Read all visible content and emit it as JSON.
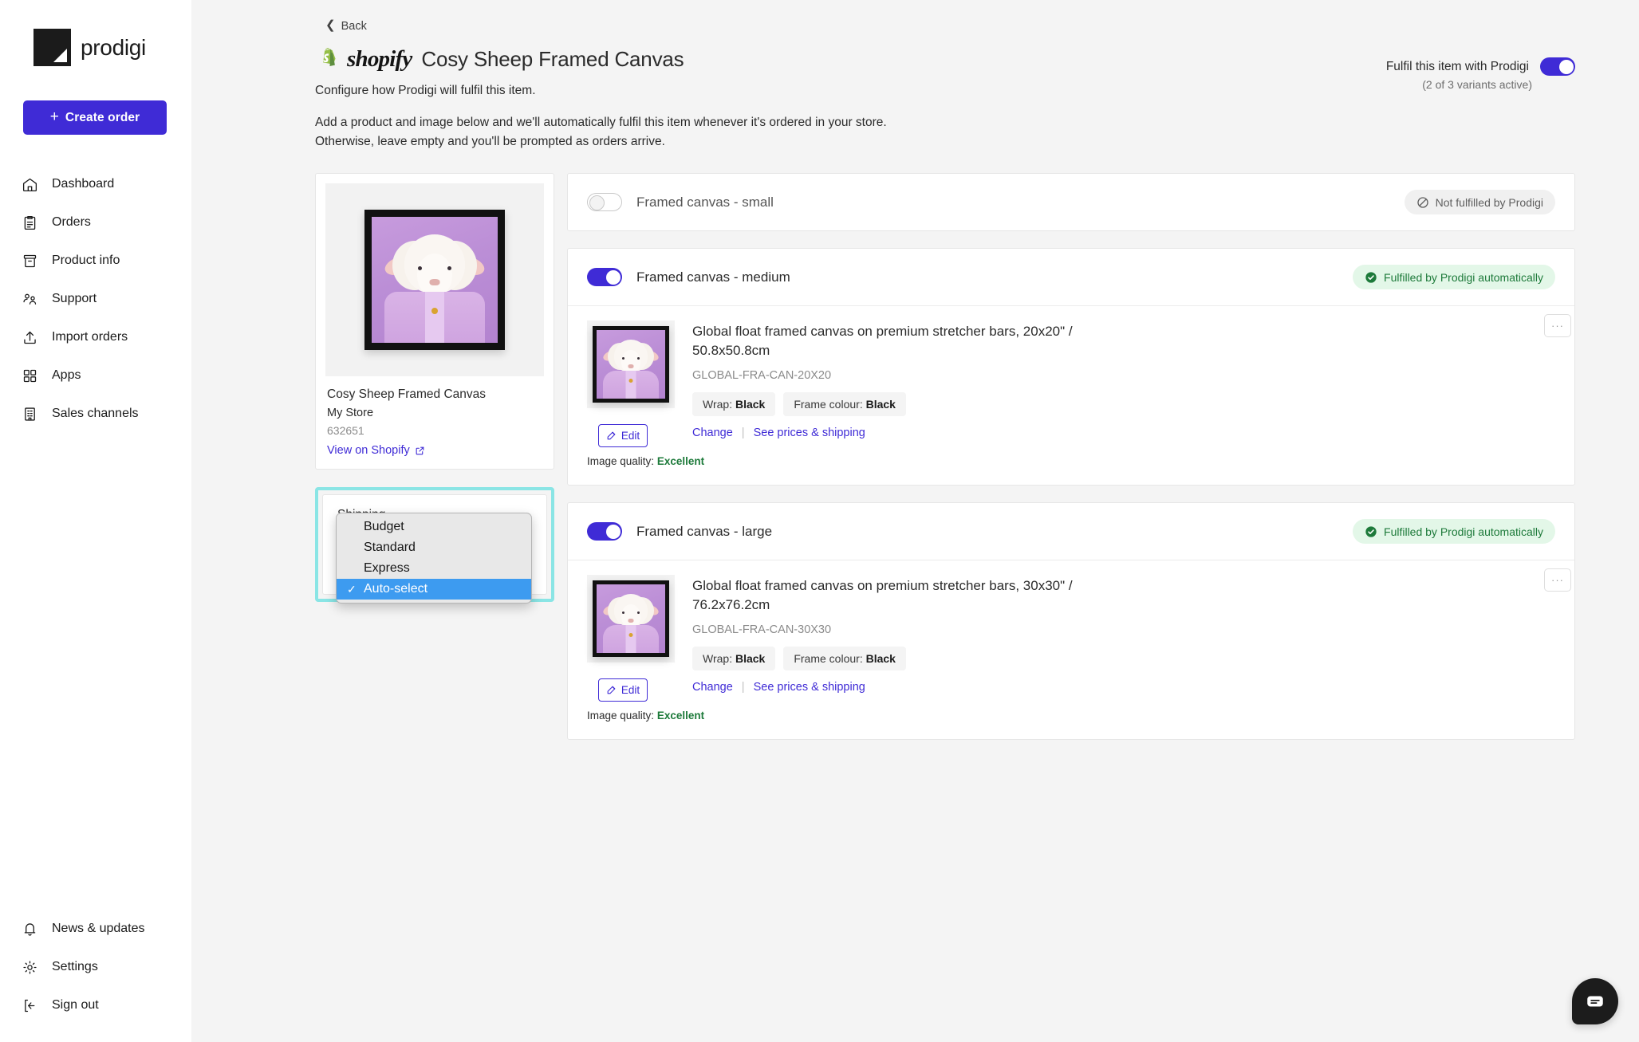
{
  "brand": {
    "name": "prodigi",
    "logo_icon": "prodigi-logo-icon"
  },
  "sidebar": {
    "create_order_label": "Create order",
    "create_order_plus": "+",
    "items": [
      {
        "label": "Dashboard",
        "icon": "home-icon"
      },
      {
        "label": "Orders",
        "icon": "clipboard-icon"
      },
      {
        "label": "Product info",
        "icon": "archive-box-icon"
      },
      {
        "label": "Support",
        "icon": "people-icon"
      },
      {
        "label": "Import orders",
        "icon": "upload-icon"
      },
      {
        "label": "Apps",
        "icon": "grid-icon"
      },
      {
        "label": "Sales channels",
        "icon": "building-icon"
      }
    ],
    "bottom_items": [
      {
        "label": "News & updates",
        "icon": "bell-icon"
      },
      {
        "label": "Settings",
        "icon": "gear-icon"
      },
      {
        "label": "Sign out",
        "icon": "sign-out-icon"
      }
    ]
  },
  "header": {
    "back_label": "Back",
    "channel_logo": "shopify-logo-icon",
    "channel_word": "shopify",
    "title": "Cosy Sheep Framed Canvas",
    "subtitle": "Configure how Prodigi will fulfil this item.",
    "blurb_line1": "Add a product and image below and we'll automatically fulfil this item whenever it's ordered in your store.",
    "blurb_line2": "Otherwise, leave empty and you'll be prompted as orders arrive.",
    "fulfil_label": "Fulfil this item with Prodigi",
    "fulfil_sub": "(2 of 3 variants active)",
    "fulfil_toggle_on": true
  },
  "product_card": {
    "image_alt": "Cosy Sheep Framed Canvas preview",
    "name": "Cosy Sheep Framed Canvas",
    "store": "My Store",
    "id": "632651",
    "view_link": "View on Shopify",
    "external_icon": "external-link-icon"
  },
  "shipping_card": {
    "label": "Shipping",
    "selected_value": "Auto-select",
    "dropdown_open": true,
    "options": [
      {
        "label": "Budget",
        "selected": false
      },
      {
        "label": "Standard",
        "selected": false
      },
      {
        "label": "Express",
        "selected": false
      },
      {
        "label": "Auto-select",
        "selected": true
      }
    ],
    "check_glyph": "✓",
    "highlight_color": "#8ae5e5"
  },
  "variants": [
    {
      "name": "Framed canvas - small",
      "enabled": false,
      "status_label": "Not fulfilled by Prodigi",
      "status_type": "none",
      "status_icon": "no-entry-icon",
      "has_product": false
    },
    {
      "name": "Framed canvas - medium",
      "enabled": true,
      "status_label": "Fulfilled by Prodigi automatically",
      "status_type": "ok",
      "status_icon": "check-circle-icon",
      "has_product": true,
      "product": {
        "title": "Global float framed canvas on premium stretcher bars, 20x20\" / 50.8x50.8cm",
        "sku": "GLOBAL-FRA-CAN-20X20",
        "attributes": [
          {
            "key": "Wrap:",
            "value": "Black"
          },
          {
            "key": "Frame colour:",
            "value": "Black"
          }
        ],
        "change_label": "Change",
        "prices_label": "See prices & shipping",
        "edit_label": "Edit",
        "edit_icon": "pencil-square-icon",
        "quality_label": "Image quality:",
        "quality_value": "Excellent",
        "kebab_label": "···"
      }
    },
    {
      "name": "Framed canvas - large",
      "enabled": true,
      "status_label": "Fulfilled by Prodigi automatically",
      "status_type": "ok",
      "status_icon": "check-circle-icon",
      "has_product": true,
      "product": {
        "title": "Global float framed canvas on premium stretcher bars, 30x30\" / 76.2x76.2cm",
        "sku": "GLOBAL-FRA-CAN-30X30",
        "attributes": [
          {
            "key": "Wrap:",
            "value": "Black"
          },
          {
            "key": "Frame colour:",
            "value": "Black"
          }
        ],
        "change_label": "Change",
        "prices_label": "See prices & shipping",
        "edit_label": "Edit",
        "edit_icon": "pencil-square-icon",
        "quality_label": "Image quality:",
        "quality_value": "Excellent",
        "kebab_label": "···"
      }
    }
  ],
  "chat": {
    "icon": "chat-bubble-icon"
  },
  "colors": {
    "accent": "#3f2bd6",
    "page_bg": "#f4f4f4",
    "success": "#1d7a3a",
    "success_bg": "#e3f7e8",
    "highlight": "#8ae5e5",
    "dropdown_selected": "#3d9bf0"
  }
}
